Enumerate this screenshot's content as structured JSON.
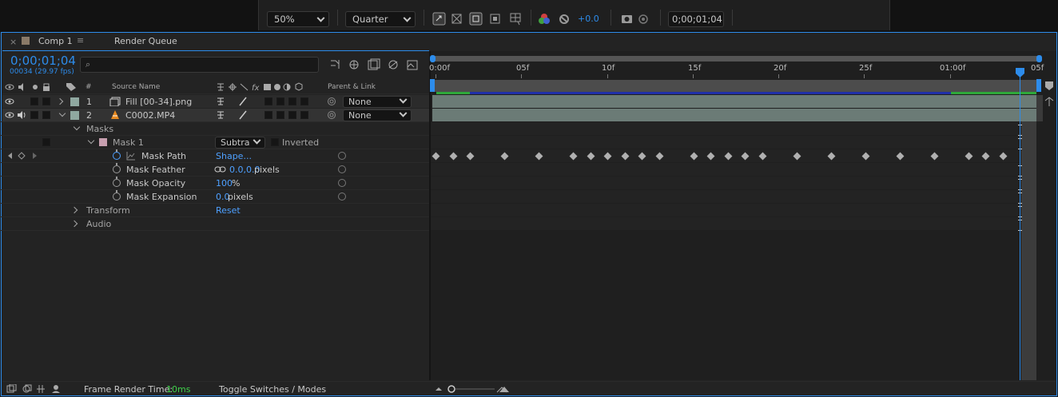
{
  "toolbar": {
    "zoom": "50%",
    "resolution": "Quarter",
    "exposure": "+0.0",
    "timecode": "0;00;01;04",
    "colors": {
      "accent": "#2d8ceb"
    }
  },
  "tabs": {
    "comp": "Comp 1",
    "render_queue": "Render Queue"
  },
  "time": {
    "current": "0;00;01;04",
    "frames": "00034 (29.97 fps)",
    "search_placeholder": ""
  },
  "columns": {
    "num": "#",
    "source_name": "Source Name",
    "parent": "Parent & Link"
  },
  "layers": [
    {
      "num": "1",
      "name": "Fill [00-34].png",
      "parent": "None",
      "color": "#8fa8a0"
    },
    {
      "num": "2",
      "name": "C0002.MP4",
      "parent": "None",
      "color": "#8fa8a0"
    }
  ],
  "props": {
    "masks": "Masks",
    "mask1": "Mask 1",
    "mode": "Subtra",
    "inverted": "Inverted",
    "mask_path": {
      "label": "Mask Path",
      "value": "Shape..."
    },
    "mask_feather": {
      "label": "Mask Feather",
      "value": "0.0,0.0",
      "unit": " pixels"
    },
    "mask_opacity": {
      "label": "Mask Opacity",
      "value": "100",
      "unit": "%"
    },
    "mask_expansion": {
      "label": "Mask Expansion",
      "value": "0.0",
      "unit": " pixels"
    },
    "transform": {
      "label": "Transform",
      "value": "Reset"
    },
    "audio": "Audio"
  },
  "ruler": {
    "ticks": [
      "0:00f",
      "05f",
      "10f",
      "15f",
      "20f",
      "25f",
      "01:00f",
      "05f"
    ],
    "playhead_frame": 34
  },
  "keyframe_frames": [
    0,
    1,
    2,
    4,
    6,
    8,
    9,
    10,
    11,
    12,
    13,
    15,
    16,
    17,
    18,
    19,
    21,
    23,
    25,
    27,
    29,
    31,
    32,
    33
  ],
  "status": {
    "frame_render_label": "Frame Render Time:",
    "frame_render_value": "10ms",
    "toggle": "Toggle Switches / Modes"
  }
}
